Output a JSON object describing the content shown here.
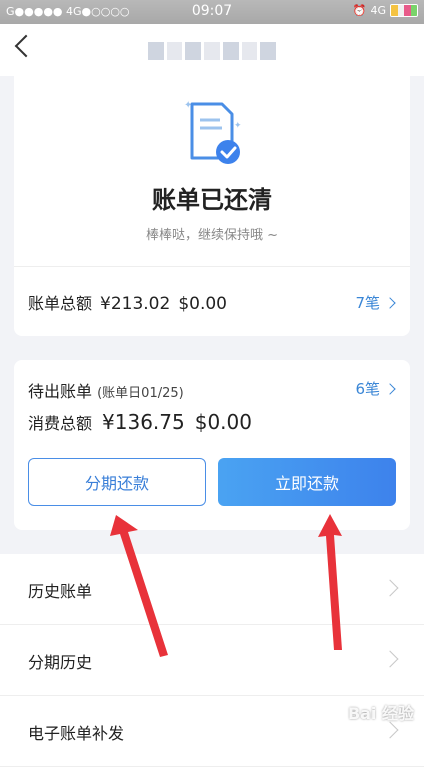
{
  "status_bar": {
    "signal": "G●●●●● 4G●○○○○",
    "time": "09:07",
    "network": "4G",
    "battery_colors": [
      "#f5c342",
      "#f0f0f0",
      "#e85b8a",
      "#7ad36b"
    ]
  },
  "nav": {
    "back_icon": "chevron-left-icon"
  },
  "summary": {
    "icon": "document-check-icon",
    "title": "账单已还清",
    "subtitle": "棒棒哒，继续保持哦 ~",
    "total_label": "账单总额",
    "total_amount": "¥213.02",
    "total_paid": "$0.00",
    "count": "7笔"
  },
  "pending_bill": {
    "label": "待出账单",
    "date": "(账单日01/25)",
    "count": "6笔",
    "consume_label": "消费总额",
    "consume_amount": "¥136.75",
    "consume_paid": "$0.00",
    "installment_button": "分期还款",
    "pay_button": "立即还款"
  },
  "menu": [
    {
      "label": "历史账单"
    },
    {
      "label": "分期历史"
    },
    {
      "label": "电子账单补发"
    }
  ],
  "colors": {
    "accent": "#3a86d6",
    "annotation_arrow": "#e8323a"
  },
  "watermark": "Bai 经验"
}
